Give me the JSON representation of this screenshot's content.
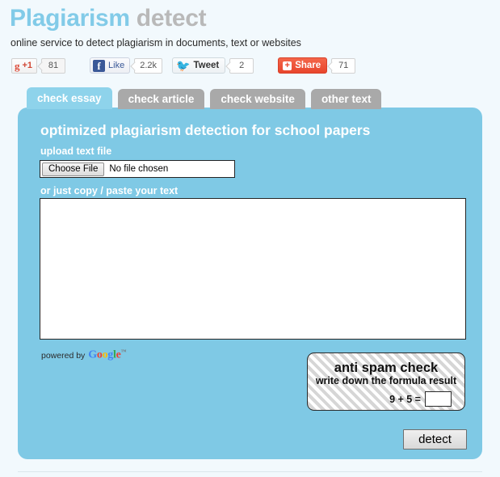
{
  "header": {
    "title_primary": "Plagiarism",
    "title_secondary": "detect",
    "tagline": "online service to detect plagiarism in documents, text or websites"
  },
  "social": {
    "gplus": {
      "glyph": "g",
      "label": "+1",
      "count": "81"
    },
    "facebook": {
      "glyph": "f",
      "label": "Like",
      "count": "2.2k"
    },
    "twitter": {
      "glyph": "✐",
      "label": "Tweet",
      "count": "2"
    },
    "share": {
      "glyph": "+",
      "label": "Share",
      "count": "71"
    }
  },
  "tabs": [
    {
      "label": "check essay",
      "active": true
    },
    {
      "label": "check article",
      "active": false
    },
    {
      "label": "check website",
      "active": false
    },
    {
      "label": "other text",
      "active": false
    }
  ],
  "panel": {
    "heading": "optimized plagiarism detection for school papers",
    "upload_label": "upload text file",
    "file_button": "Choose File",
    "file_status": "No file chosen",
    "paste_label": "or just copy / paste your text",
    "paste_value": "",
    "paste_placeholder": "",
    "powered_by": "powered by",
    "google_letters": [
      "G",
      "o",
      "o",
      "g",
      "l",
      "e"
    ],
    "google_tm": "™"
  },
  "antispam": {
    "title": "anti spam check",
    "subtitle": "write down the formula result",
    "formula": "9 + 5 =",
    "answer_value": "",
    "answer_placeholder": ""
  },
  "actions": {
    "detect_label": "detect"
  },
  "colors": {
    "brand_blue": "#7fc9e5",
    "title_blue": "#82cbe8",
    "title_gray": "#b9b9b9",
    "tab_inactive": "#a9a9a9",
    "tab_active": "#8ed3eb",
    "page_bg": "#f2f9fd",
    "share_red": "#e8452c",
    "facebook_blue": "#3b5998",
    "twitter_blue": "#1da1f2"
  }
}
